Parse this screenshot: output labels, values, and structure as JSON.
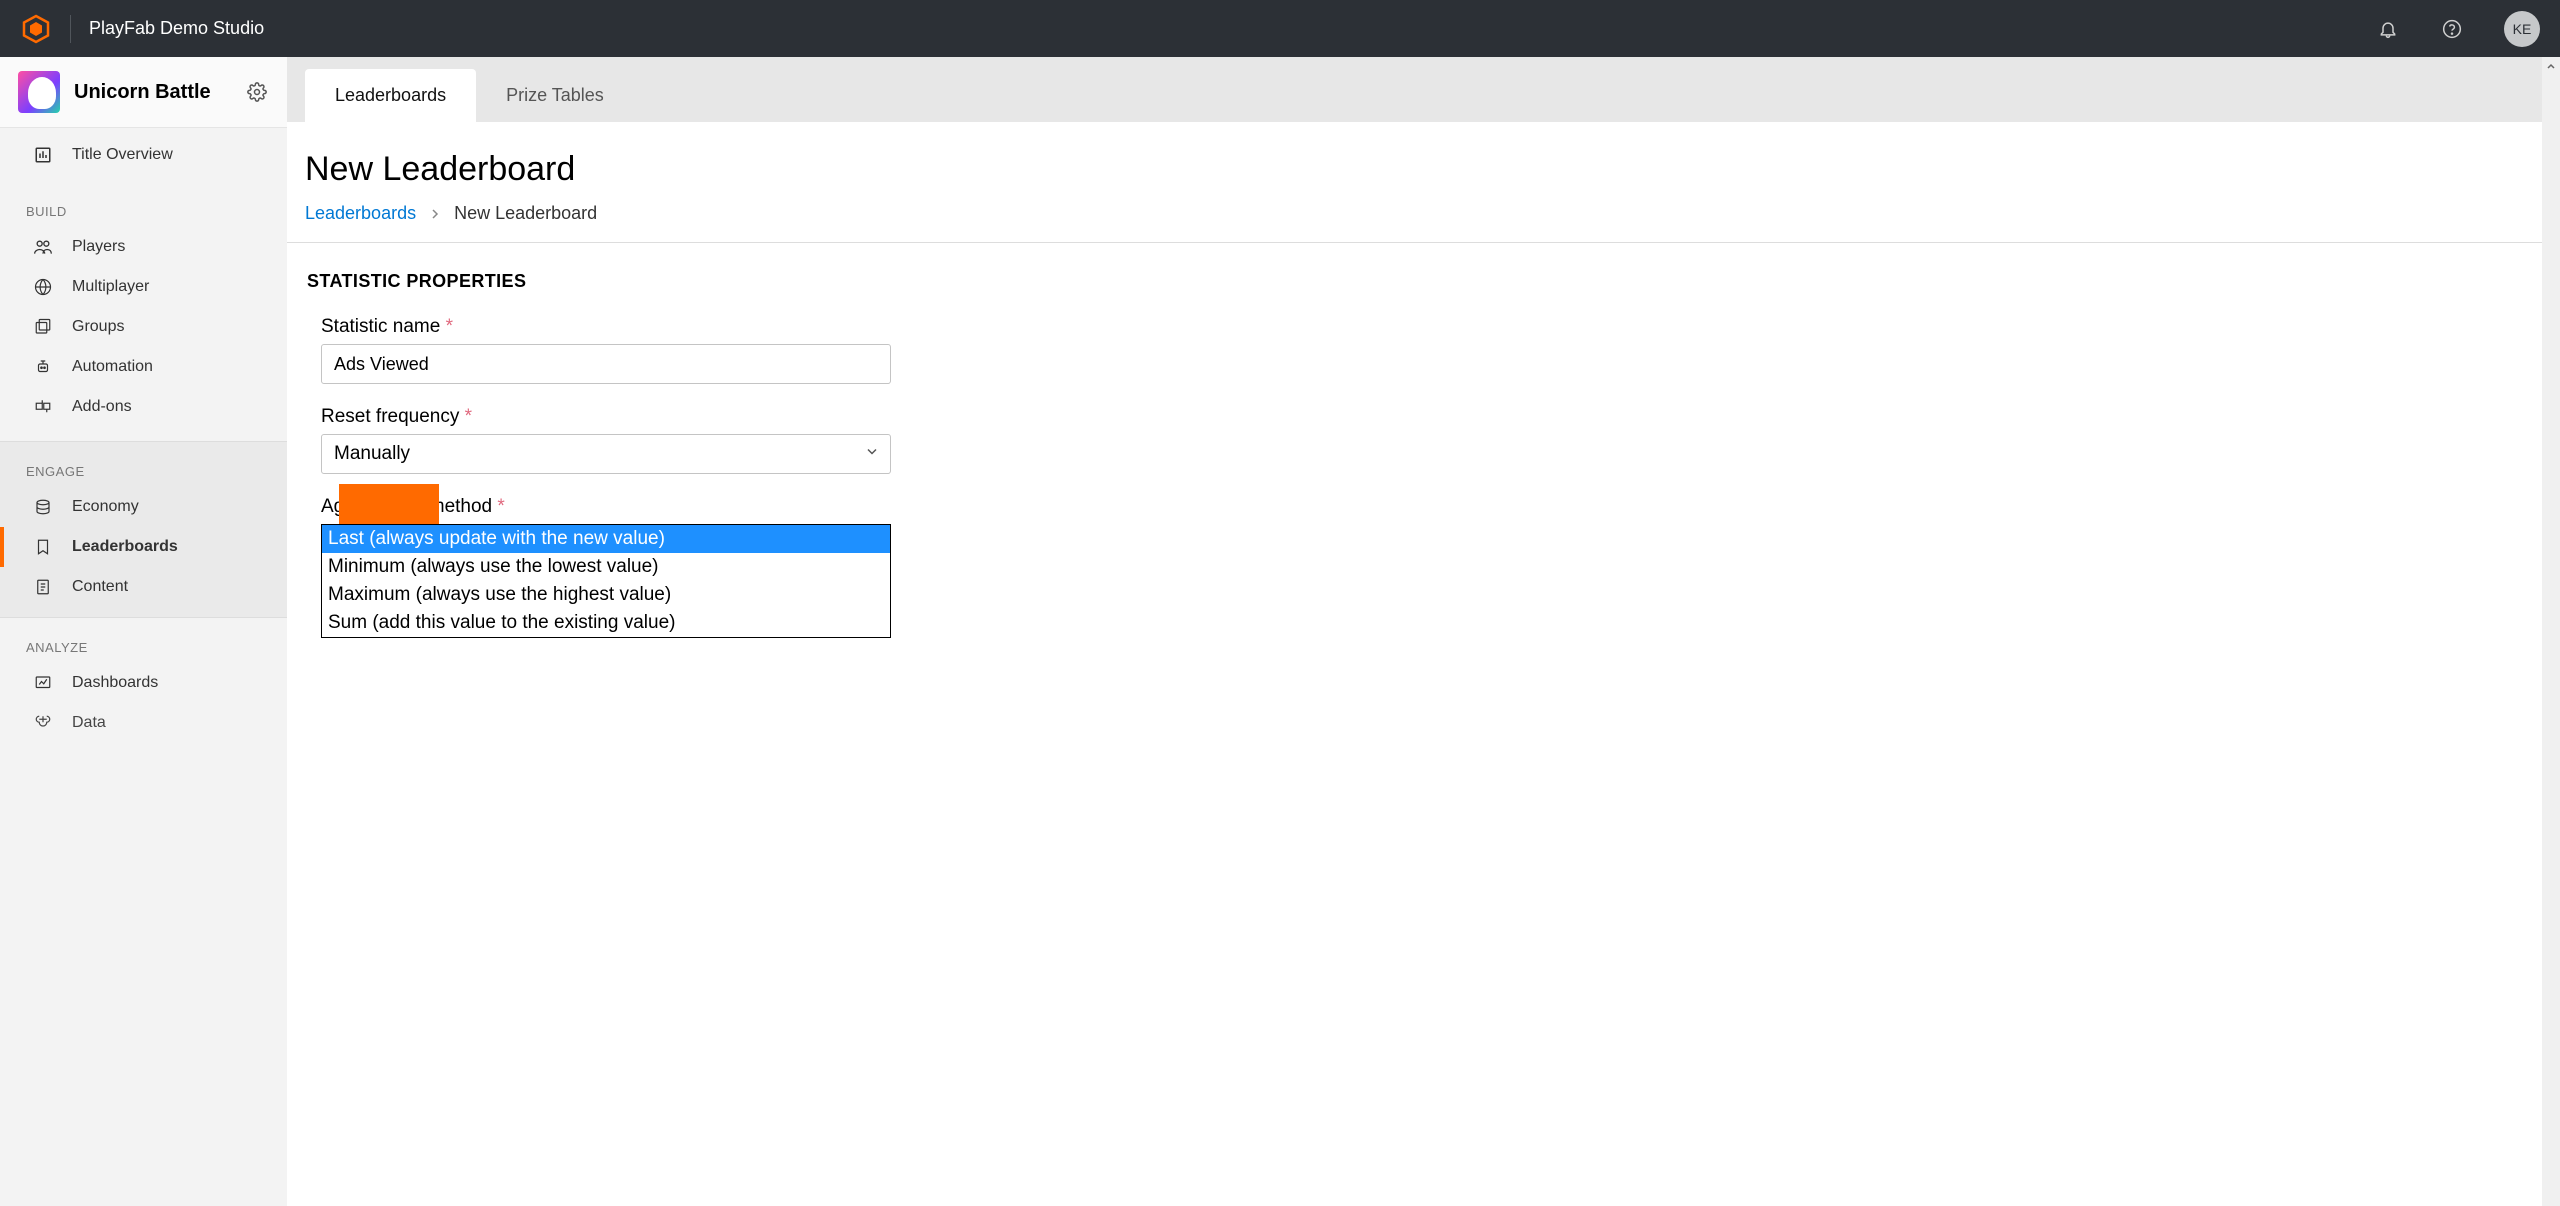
{
  "header": {
    "studio_name": "PlayFab Demo Studio",
    "avatar_initials": "KE"
  },
  "sidebar": {
    "game_title": "Unicorn Battle",
    "title_overview": "Title Overview",
    "sections": {
      "build": {
        "label": "BUILD",
        "items": [
          "Players",
          "Multiplayer",
          "Groups",
          "Automation",
          "Add-ons"
        ]
      },
      "engage": {
        "label": "ENGAGE",
        "items": [
          "Economy",
          "Leaderboards",
          "Content"
        ]
      },
      "analyze": {
        "label": "ANALYZE",
        "items": [
          "Dashboards",
          "Data"
        ]
      }
    }
  },
  "tabs": {
    "leaderboards": "Leaderboards",
    "prize_tables": "Prize Tables"
  },
  "page": {
    "title": "New Leaderboard",
    "breadcrumb_root": "Leaderboards",
    "breadcrumb_current": "New Leaderboard"
  },
  "form": {
    "section_heading": "STATISTIC PROPERTIES",
    "statistic_name_label": "Statistic name",
    "statistic_name_value": "Ads Viewed",
    "reset_frequency_label": "Reset frequency",
    "reset_frequency_value": "Manually",
    "aggregation_method_label": "Aggregation method",
    "aggregation_options": [
      "Last (always update with the new value)",
      "Minimum (always use the lowest value)",
      "Maximum (always use the highest value)",
      "Sum (add this value to the existing value)"
    ]
  }
}
